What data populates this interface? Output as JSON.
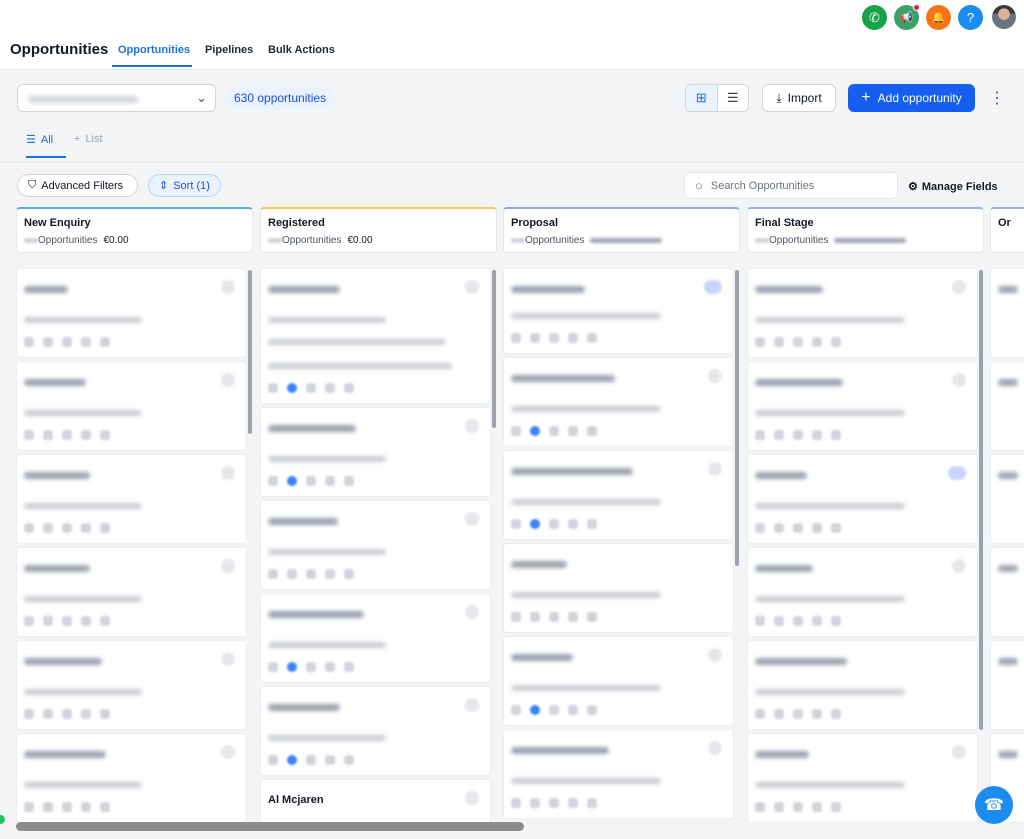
{
  "header": {
    "title": "Opportunities",
    "tabs": [
      "Opportunities",
      "Pipelines",
      "Bulk Actions"
    ],
    "icons": {
      "phone": {
        "symbol": "✆",
        "color": "#16a34a"
      },
      "megaphone": {
        "symbol": "📢",
        "color": "#3aa36a"
      },
      "bell": {
        "symbol": "🔔",
        "color": "#f97316"
      },
      "help": {
        "symbol": "?",
        "color": "#1d8cf0"
      }
    }
  },
  "toolbar": {
    "opportunity_count": "630 opportunities",
    "import_label": "Import",
    "add_label": "Add opportunity",
    "kebab": "⋮",
    "grid_icon": "⊞",
    "list_icon": "☰",
    "chevron": "⌄",
    "import_icon": "⤓",
    "plus_icon": "+"
  },
  "views": {
    "all_label": "All",
    "all_icon": "☰",
    "list_label": "List",
    "list_icon": "+"
  },
  "filters": {
    "advanced_label": "Advanced Filters",
    "advanced_icon": "⛉",
    "sort_label": "Sort (1)",
    "sort_icon": "⇕",
    "search_placeholder": "Search Opportunities",
    "search_icon": "○",
    "manage_label": "Manage Fields",
    "manage_icon": "⚙"
  },
  "stages": [
    {
      "name": "New Enquiry",
      "meta_label": "Opportunities",
      "amount": "€0.00",
      "color": "#4fb3e8"
    },
    {
      "name": "Registered",
      "meta_label": "Opportunities",
      "amount": "€0.00",
      "color": "#f6c55b"
    },
    {
      "name": "Proposal",
      "meta_label": "Opportunities",
      "amount": "",
      "color": "#9aa5f0"
    },
    {
      "name": "Final Stage",
      "meta_label": "Opportunities",
      "amount": "",
      "color": "#8fb1f5"
    },
    {
      "name": "Or",
      "meta_label": "",
      "amount": "",
      "color": "#8fb1f5"
    }
  ],
  "cards": {
    "visible_name": "Al Mcjaren"
  }
}
